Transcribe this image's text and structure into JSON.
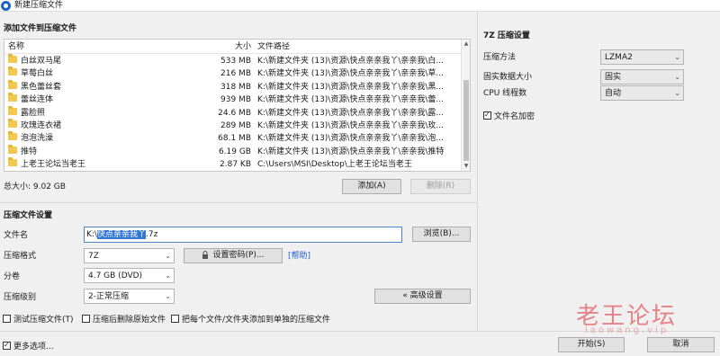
{
  "window": {
    "title": "新建压缩文件"
  },
  "files_section": {
    "title": "添加文件到压缩文件",
    "columns": {
      "name": "名称",
      "size": "大小",
      "path": "文件路径"
    },
    "rows": [
      {
        "name": "白丝双马尾",
        "size": "533 MB",
        "path": "K:\\新建文件夹 (13)\\资源\\快点亲亲我丫\\亲亲我\\白..."
      },
      {
        "name": "草莓白丝",
        "size": "216 MB",
        "path": "K:\\新建文件夹 (13)\\资源\\快点亲亲我丫\\亲亲我\\草..."
      },
      {
        "name": "黑色蕾丝套",
        "size": "318 MB",
        "path": "K:\\新建文件夹 (13)\\资源\\快点亲亲我丫\\亲亲我\\黑..."
      },
      {
        "name": "蕾丝连体",
        "size": "939 MB",
        "path": "K:\\新建文件夹 (13)\\资源\\快点亲亲我丫\\亲亲我\\蕾..."
      },
      {
        "name": "露脸照",
        "size": "24.6 MB",
        "path": "K:\\新建文件夹 (13)\\资源\\快点亲亲我丫\\亲亲我\\露..."
      },
      {
        "name": "玫瑰连衣裙",
        "size": "289 MB",
        "path": "K:\\新建文件夹 (13)\\资源\\快点亲亲我丫\\亲亲我\\玫..."
      },
      {
        "name": "泡泡洗澡",
        "size": "68.1 MB",
        "path": "K:\\新建文件夹 (13)\\资源\\快点亲亲我丫\\亲亲我\\泡..."
      },
      {
        "name": "推特",
        "size": "6.19 GB",
        "path": "K:\\新建文件夹 (13)\\资源\\快点亲亲我丫\\亲亲我\\推特"
      },
      {
        "name": "上老王论坛当老王",
        "size": "2.87 KB",
        "path": "C:\\Users\\MSI\\Desktop\\上老王论坛当老王"
      }
    ],
    "total_size": "总大小: 9.02 GB",
    "add_button": "添加(A)",
    "delete_button": "删除(R)"
  },
  "settings_section": {
    "title": "压缩文件设置",
    "filename_label": "文件名",
    "filename_prefix": "K:\\",
    "filename_selected": "快点亲亲我丫",
    "filename_suffix": ".7z",
    "browse_button": "浏览(B)...",
    "format_label": "压缩格式",
    "format_value": "7Z",
    "set_password_button": "设置密码(P)...",
    "help_link": "[帮助]",
    "split_label": "分卷",
    "split_value": "4.7 GB (DVD)",
    "level_label": "压缩级别",
    "level_value": "2-正常压缩",
    "advanced_button": "« 高级设置",
    "test_checkbox": "测试压缩文件(T)",
    "delete_after_checkbox": "压缩后删除原始文件",
    "separate_checkbox": "把每个文件/文件夹添加到单独的压缩文件"
  },
  "sevenz_section": {
    "title": "7Z 压缩设置",
    "method_label": "压缩方法",
    "method_value": "LZMA2",
    "solid_label": "固实数据大小",
    "solid_value": "固实",
    "threads_label": "CPU 线程数",
    "threads_value": "自动",
    "encrypt_names_label": "文件名加密"
  },
  "bottom": {
    "more_options": "更多选项...",
    "start_button": "开始(S)",
    "cancel_button": "取消"
  },
  "watermark": {
    "text": "老王论坛",
    "sub": "laowang.vip"
  }
}
